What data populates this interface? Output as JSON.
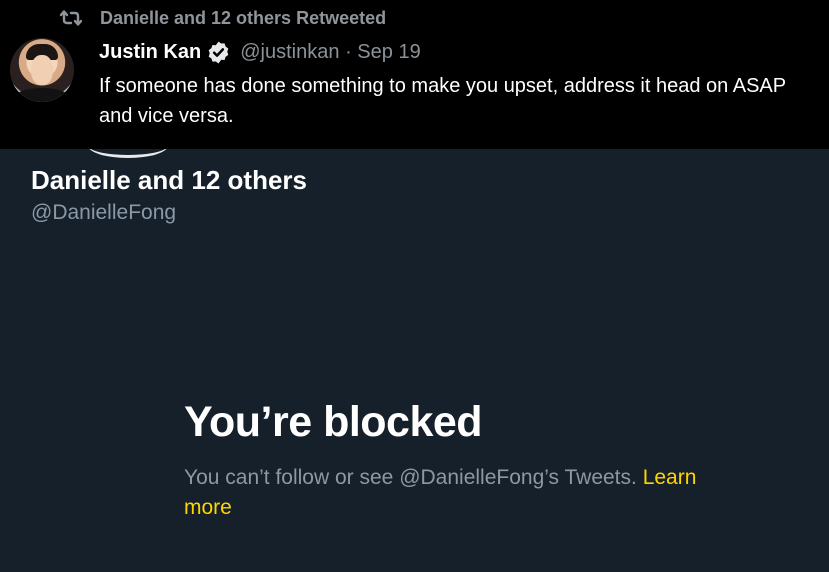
{
  "retweet": {
    "icon": "retweet-icon",
    "text": "Danielle and 12 others Retweeted"
  },
  "tweet": {
    "author_name": "Justin Kan",
    "verified_icon": "verified-badge-icon",
    "handle": "@justinkan",
    "separator": "·",
    "date": "Sep 19",
    "text": "If someone has done something to make you upset, address it head on ASAP and vice versa."
  },
  "profile": {
    "name": "Danielle and 12 others",
    "handle": "@DanielleFong"
  },
  "blocked": {
    "title": "You’re blocked",
    "description": "You can’t follow or see @DanielleFong’s Tweets. ",
    "learn_more": "Learn more"
  },
  "colors": {
    "background": "#15202b",
    "tweet_panel": "#000000",
    "link_accent": "#ffd400",
    "secondary_text": "#8b98a5"
  }
}
